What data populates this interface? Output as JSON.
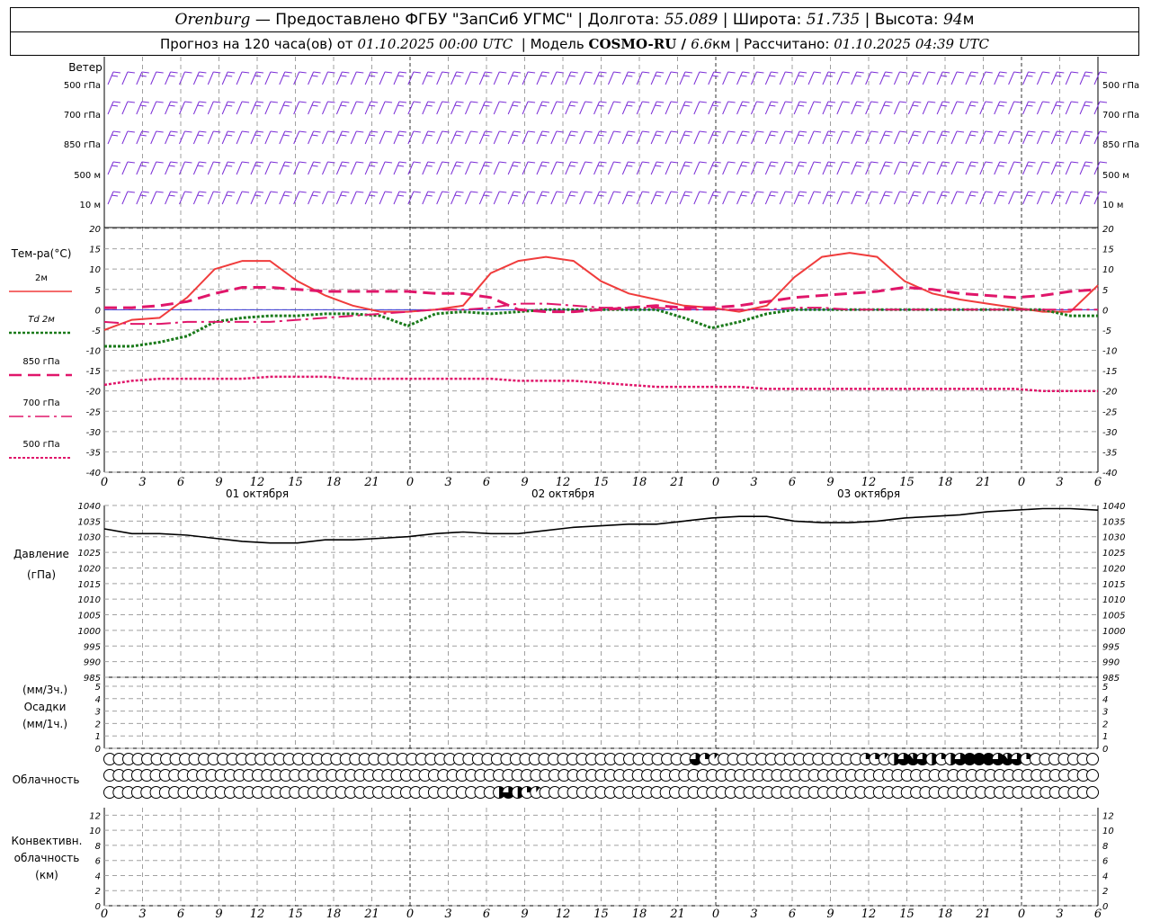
{
  "header": {
    "city": "Orenburg",
    "provider": " — Предоставлено ФГБУ \"ЗапСиб УГМС\" | Долгота: ",
    "lon": "55.089",
    "lat_label": " | Широта: ",
    "lat": "51.735",
    "alt_label": " | Высота: ",
    "alt": "94",
    "alt_unit": "м",
    "forecast_label": "Прогноз на 120 часа(ов) от ",
    "forecast_time": "01.10.2025 00:00 UTC",
    "model_label": "  | Модель ",
    "model": "COSMO-RU / ",
    "resolution": "6.6",
    "res_unit": "км",
    "calc_label": " | Рассчитано: ",
    "calc_time": "01.10.2025 04:39 UTC"
  },
  "labels": {
    "wind": "Ветер",
    "wind_levels": [
      "500 гПа",
      "700 гПа",
      "850 гПа",
      "500 м",
      "10  м"
    ],
    "temp": "Тем-ра(°C)",
    "legend": [
      "2м",
      "Td  2м",
      "850 гПа",
      "700 гПа",
      "500 гПа"
    ],
    "pressure": "Давление",
    "pressure_unit": "(гПа)",
    "precip_unit1": "(мм/3ч.)",
    "precip": "Осадки",
    "precip_unit2": "(мм/1ч.)",
    "cloud": "Облачность",
    "conv1": "Конвективн.",
    "conv2": "облачность",
    "conv3": "(км)"
  },
  "time_axis": {
    "ticks": [
      "0",
      "3",
      "6",
      "9",
      "12",
      "15",
      "18",
      "21",
      "0",
      "3",
      "6",
      "9",
      "12",
      "15",
      "18",
      "21",
      "0",
      "3",
      "6",
      "9",
      "12",
      "15",
      "18",
      "21",
      "0",
      "3",
      "6"
    ],
    "days": [
      "01 октября",
      "02 октября",
      "03 октября"
    ]
  },
  "colors": {
    "wind": "#7b2fd6",
    "t2m": "#f03c3c",
    "td2m": "#1a7a1a",
    "t850": "#e0166a",
    "t700": "#e0166a",
    "t500": "#e0166a",
    "pressure": "#000000",
    "grid": "#a0a0a0"
  },
  "chart_data": [
    {
      "type": "line",
      "title": "Тем-ра(°C)",
      "x_hours": [
        0,
        3,
        6,
        9,
        12,
        15,
        18,
        21,
        24,
        27,
        30,
        33,
        36,
        39,
        42,
        45,
        48,
        51,
        54,
        57,
        60,
        63,
        66,
        69,
        72,
        75,
        78,
        81,
        84,
        87,
        90,
        93,
        96,
        99,
        102,
        105,
        108,
        111,
        114,
        117,
        120
      ],
      "ylim": [
        -40,
        20
      ],
      "series": [
        {
          "name": "2м",
          "values": [
            -5,
            -2.5,
            -2,
            3,
            10,
            12,
            12,
            7,
            3.5,
            1,
            -0.5,
            -0.5,
            0,
            1,
            9,
            12,
            13,
            12,
            7,
            4,
            2.5,
            1,
            0.5,
            -0.5,
            1,
            8,
            13,
            14,
            13,
            7,
            4,
            2.5,
            1.5,
            0.5,
            -0.5,
            -0.5,
            6
          ]
        },
        {
          "name": "Td  2м",
          "values": [
            -9,
            -9,
            -8,
            -6.5,
            -3,
            -2,
            -1.5,
            -1.5,
            -1,
            -1,
            -1.5,
            -4,
            -1,
            -0.5,
            -1,
            -0.5,
            0,
            0,
            0,
            0,
            0,
            -2,
            -4.5,
            -3,
            -1,
            0,
            0,
            0,
            0,
            0,
            0,
            0,
            0,
            0,
            0,
            -1.5,
            -1.5
          ]
        },
        {
          "name": "850 гПа",
          "values": [
            0.5,
            0.5,
            1,
            2,
            4,
            5.5,
            5.5,
            5,
            4.5,
            4.5,
            4.5,
            4.5,
            4,
            4,
            3,
            0,
            -0.5,
            -0.5,
            0,
            0.5,
            1,
            0.5,
            0.5,
            1,
            2,
            3,
            3.5,
            4,
            4.5,
            5.5,
            5,
            4,
            3.5,
            3,
            3.5,
            4.5,
            5
          ]
        },
        {
          "name": "700 гПа",
          "values": [
            -3,
            -3.5,
            -3.5,
            -3,
            -3,
            -3,
            -3,
            -2.5,
            -2,
            -1.5,
            -1,
            -0.5,
            0,
            0,
            0.5,
            1.5,
            1.5,
            1,
            0.5,
            0.5,
            0.5,
            0,
            0,
            0,
            0,
            0.5,
            0.5,
            0,
            0,
            0,
            0,
            0,
            0,
            0,
            0,
            0,
            0
          ]
        },
        {
          "name": "500 гПа",
          "values": [
            -18.5,
            -17.5,
            -17,
            -17,
            -17,
            -17,
            -16.5,
            -16.5,
            -16.5,
            -17,
            -17,
            -17,
            -17,
            -17,
            -17,
            -17.5,
            -17.5,
            -17.5,
            -18,
            -18.5,
            -19,
            -19,
            -19,
            -19,
            -19.5,
            -19.5,
            -19.5,
            -19.5,
            -19.5,
            -19.5,
            -19.5,
            -19.5,
            -19.5,
            -19.5,
            -20,
            -20,
            -20
          ]
        }
      ]
    },
    {
      "type": "line",
      "title": "Давление",
      "ylabel": "(гПа)",
      "ylim": [
        985,
        1040
      ],
      "ticks": [
        1040,
        1035,
        1030,
        1025,
        1020,
        1015,
        1010,
        1005,
        1000,
        995,
        990,
        985
      ],
      "series": [
        {
          "name": "Давление",
          "values": [
            1032.5,
            1031,
            1031,
            1030.5,
            1029.5,
            1028.5,
            1028,
            1028,
            1029,
            1029,
            1029.5,
            1030,
            1031,
            1031.5,
            1031,
            1031,
            1032,
            1033,
            1033.5,
            1034,
            1034,
            1035,
            1036,
            1036.5,
            1036.5,
            1035,
            1034.5,
            1034.5,
            1035,
            1036,
            1036.5,
            1037,
            1038,
            1038.5,
            1039,
            1039,
            1038.5
          ]
        }
      ]
    },
    {
      "type": "bar",
      "title": "Осадки",
      "ylim": [
        0,
        5
      ],
      "ticks": [
        5,
        4,
        3,
        2,
        1,
        0
      ],
      "values": []
    },
    {
      "type": "scatter",
      "title": "Облачность",
      "rows": 3,
      "row_fractions": [
        [
          0,
          0,
          0,
          0,
          0,
          0,
          0,
          0,
          0,
          0,
          0,
          0,
          0,
          0,
          0,
          0,
          0,
          0,
          0,
          0,
          0,
          0,
          0,
          0,
          0,
          0,
          0,
          0,
          0,
          0,
          0,
          0,
          0,
          0,
          0,
          0,
          0,
          0,
          0,
          0,
          0,
          0,
          0,
          0,
          0,
          0,
          0,
          0,
          0,
          0,
          0,
          0,
          0,
          0,
          0,
          0,
          0,
          0,
          0,
          0,
          0,
          0,
          0.75,
          0.25,
          0.1,
          0,
          0,
          0,
          0,
          0,
          0,
          0,
          0,
          0,
          0,
          0,
          0,
          0,
          0,
          0,
          0.25,
          0.25,
          0.1,
          0.5,
          0.75,
          0.9,
          0.75,
          0.5,
          0.25,
          0.5,
          0.75,
          1,
          1,
          1,
          0.75,
          0.9,
          0.75,
          0.25,
          0,
          0,
          0,
          0,
          0,
          0,
          0
        ],
        [
          0,
          0,
          0,
          0,
          0,
          0,
          0,
          0,
          0,
          0,
          0,
          0,
          0,
          0,
          0,
          0,
          0,
          0,
          0,
          0,
          0,
          0,
          0,
          0,
          0,
          0,
          0,
          0,
          0,
          0,
          0,
          0,
          0,
          0,
          0,
          0,
          0,
          0,
          0,
          0,
          0,
          0,
          0,
          0,
          0,
          0,
          0,
          0,
          0,
          0,
          0,
          0,
          0,
          0,
          0,
          0,
          0,
          0,
          0,
          0,
          0,
          0,
          0,
          0,
          0,
          0,
          0,
          0,
          0,
          0,
          0,
          0,
          0,
          0,
          0,
          0,
          0,
          0,
          0,
          0,
          0,
          0,
          0,
          0,
          0,
          0,
          0,
          0,
          0,
          0,
          0,
          0,
          0,
          0,
          0,
          0,
          0,
          0,
          0,
          0,
          0,
          0,
          0,
          0,
          0,
          0,
          0
        ],
        [
          0,
          0,
          0,
          0,
          0,
          0,
          0,
          0,
          0,
          0,
          0,
          0,
          0,
          0,
          0,
          0,
          0,
          0,
          0,
          0,
          0,
          0,
          0,
          0,
          0,
          0,
          0,
          0,
          0,
          0,
          0,
          0,
          0,
          0,
          0,
          0,
          0,
          0,
          0,
          0,
          0,
          0,
          0.5,
          0.75,
          0.5,
          0.25,
          0.1,
          0,
          0,
          0,
          0,
          0,
          0,
          0,
          0,
          0,
          0,
          0,
          0,
          0,
          0,
          0,
          0,
          0,
          0,
          0,
          0,
          0,
          0,
          0,
          0,
          0,
          0,
          0,
          0,
          0,
          0,
          0,
          0,
          0,
          0,
          0,
          0,
          0,
          0,
          0,
          0,
          0,
          0,
          0,
          0,
          0,
          0,
          0,
          0,
          0,
          0,
          0,
          0,
          0,
          0,
          0,
          0,
          0,
          0,
          0,
          0
        ]
      ]
    },
    {
      "type": "bar",
      "title": "Конвективн. облачность",
      "ylabel": "(км)",
      "ylim": [
        0,
        13
      ],
      "ticks": [
        12,
        10,
        8,
        6,
        4,
        2,
        0
      ],
      "values": []
    }
  ]
}
